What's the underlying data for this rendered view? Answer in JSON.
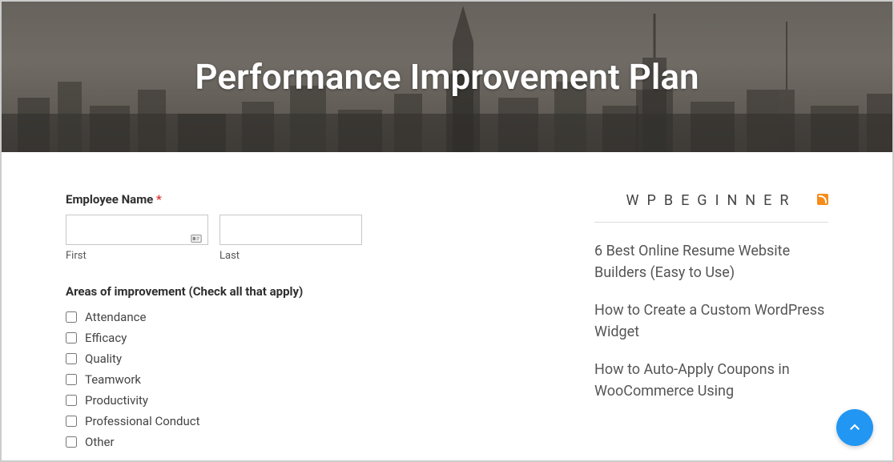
{
  "hero": {
    "title": "Performance Improvement Plan"
  },
  "form": {
    "employee_name_label": "Employee Name",
    "required_mark": "*",
    "first_sublabel": "First",
    "last_sublabel": "Last",
    "areas_label": "Areas of improvement (Check all that apply)",
    "areas": [
      {
        "label": "Attendance"
      },
      {
        "label": "Efficacy"
      },
      {
        "label": "Quality"
      },
      {
        "label": "Teamwork"
      },
      {
        "label": "Productivity"
      },
      {
        "label": "Professional Conduct"
      },
      {
        "label": "Other"
      }
    ]
  },
  "sidebar": {
    "title": "WPBEGINNER",
    "links": [
      "6 Best Online Resume Website Builders (Easy to Use)",
      "How to Create a Custom WordPress Widget",
      "How to Auto-Apply Coupons in WooCommerce Using"
    ]
  }
}
